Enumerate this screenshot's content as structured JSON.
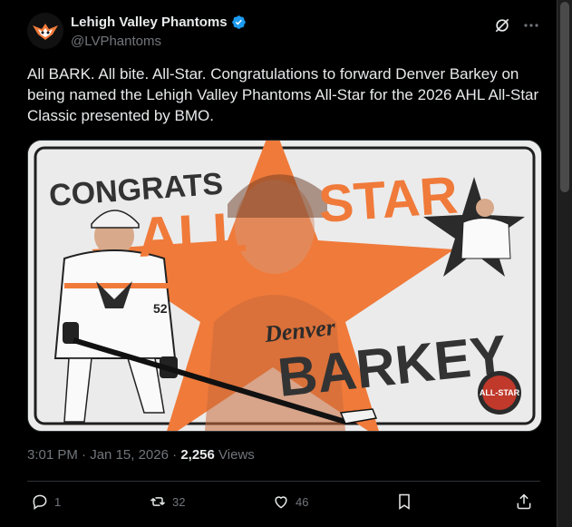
{
  "account": {
    "name": "Lehigh Valley Phantoms",
    "handle": "@LVPhantoms"
  },
  "tweet": {
    "text": "All BARK. All bite. All-Star. Congratulations to forward Denver Barkey on being named the Lehigh Valley Phantoms All-Star for the 2026 AHL All-Star Classic presented by BMO."
  },
  "media": {
    "headline_1": "CONGRATS",
    "headline_2": "ALL",
    "headline_3": "STAR",
    "first_name": "Denver",
    "last_name": "BARKEY",
    "badge_text": "ALL-STAR",
    "jersey_number": "52",
    "colors": {
      "orange": "#f07a3a",
      "dark": "#2b2b2b",
      "bg": "#e8e8e8"
    }
  },
  "meta": {
    "time": "3:01 PM",
    "date": "Jan 15, 2026",
    "views_count": "2,256",
    "views_label": "Views"
  },
  "actions": {
    "replies": "1",
    "reposts": "32",
    "likes": "46"
  },
  "icons": [
    "verified-icon",
    "grok-icon",
    "more-icon",
    "reply-icon",
    "repost-icon",
    "like-icon",
    "bookmark-icon",
    "share-icon"
  ]
}
